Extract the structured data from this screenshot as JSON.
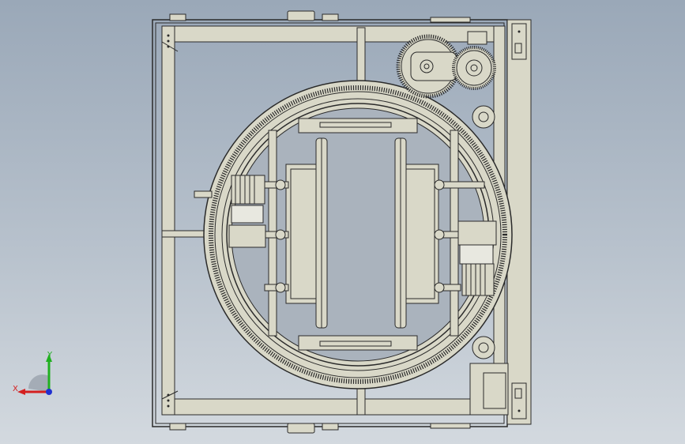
{
  "viewport": {
    "background_top": "#9aa8b8",
    "background_bottom": "#d3d9df",
    "model_stroke": "#2a2a2a",
    "model_fill": "#d9d8c8"
  },
  "triad": {
    "x_label": "X",
    "y_label": "Y",
    "x_color": "#d42020",
    "y_color": "#20b020",
    "z_color": "#2030d0"
  },
  "icons": [
    "coordinate-triad-icon",
    "ring-gear",
    "drive-gear",
    "roller"
  ]
}
